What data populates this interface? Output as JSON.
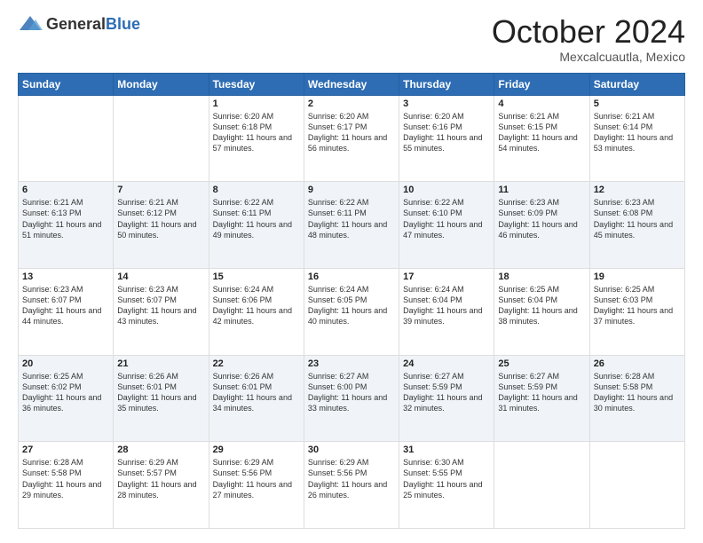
{
  "header": {
    "logo_general": "General",
    "logo_blue": "Blue",
    "month_title": "October 2024",
    "location": "Mexcalcuautla, Mexico"
  },
  "weekdays": [
    "Sunday",
    "Monday",
    "Tuesday",
    "Wednesday",
    "Thursday",
    "Friday",
    "Saturday"
  ],
  "weeks": [
    [
      {
        "day": "",
        "sunrise": "",
        "sunset": "",
        "daylight": ""
      },
      {
        "day": "",
        "sunrise": "",
        "sunset": "",
        "daylight": ""
      },
      {
        "day": "1",
        "sunrise": "Sunrise: 6:20 AM",
        "sunset": "Sunset: 6:18 PM",
        "daylight": "Daylight: 11 hours and 57 minutes."
      },
      {
        "day": "2",
        "sunrise": "Sunrise: 6:20 AM",
        "sunset": "Sunset: 6:17 PM",
        "daylight": "Daylight: 11 hours and 56 minutes."
      },
      {
        "day": "3",
        "sunrise": "Sunrise: 6:20 AM",
        "sunset": "Sunset: 6:16 PM",
        "daylight": "Daylight: 11 hours and 55 minutes."
      },
      {
        "day": "4",
        "sunrise": "Sunrise: 6:21 AM",
        "sunset": "Sunset: 6:15 PM",
        "daylight": "Daylight: 11 hours and 54 minutes."
      },
      {
        "day": "5",
        "sunrise": "Sunrise: 6:21 AM",
        "sunset": "Sunset: 6:14 PM",
        "daylight": "Daylight: 11 hours and 53 minutes."
      }
    ],
    [
      {
        "day": "6",
        "sunrise": "Sunrise: 6:21 AM",
        "sunset": "Sunset: 6:13 PM",
        "daylight": "Daylight: 11 hours and 51 minutes."
      },
      {
        "day": "7",
        "sunrise": "Sunrise: 6:21 AM",
        "sunset": "Sunset: 6:12 PM",
        "daylight": "Daylight: 11 hours and 50 minutes."
      },
      {
        "day": "8",
        "sunrise": "Sunrise: 6:22 AM",
        "sunset": "Sunset: 6:11 PM",
        "daylight": "Daylight: 11 hours and 49 minutes."
      },
      {
        "day": "9",
        "sunrise": "Sunrise: 6:22 AM",
        "sunset": "Sunset: 6:11 PM",
        "daylight": "Daylight: 11 hours and 48 minutes."
      },
      {
        "day": "10",
        "sunrise": "Sunrise: 6:22 AM",
        "sunset": "Sunset: 6:10 PM",
        "daylight": "Daylight: 11 hours and 47 minutes."
      },
      {
        "day": "11",
        "sunrise": "Sunrise: 6:23 AM",
        "sunset": "Sunset: 6:09 PM",
        "daylight": "Daylight: 11 hours and 46 minutes."
      },
      {
        "day": "12",
        "sunrise": "Sunrise: 6:23 AM",
        "sunset": "Sunset: 6:08 PM",
        "daylight": "Daylight: 11 hours and 45 minutes."
      }
    ],
    [
      {
        "day": "13",
        "sunrise": "Sunrise: 6:23 AM",
        "sunset": "Sunset: 6:07 PM",
        "daylight": "Daylight: 11 hours and 44 minutes."
      },
      {
        "day": "14",
        "sunrise": "Sunrise: 6:23 AM",
        "sunset": "Sunset: 6:07 PM",
        "daylight": "Daylight: 11 hours and 43 minutes."
      },
      {
        "day": "15",
        "sunrise": "Sunrise: 6:24 AM",
        "sunset": "Sunset: 6:06 PM",
        "daylight": "Daylight: 11 hours and 42 minutes."
      },
      {
        "day": "16",
        "sunrise": "Sunrise: 6:24 AM",
        "sunset": "Sunset: 6:05 PM",
        "daylight": "Daylight: 11 hours and 40 minutes."
      },
      {
        "day": "17",
        "sunrise": "Sunrise: 6:24 AM",
        "sunset": "Sunset: 6:04 PM",
        "daylight": "Daylight: 11 hours and 39 minutes."
      },
      {
        "day": "18",
        "sunrise": "Sunrise: 6:25 AM",
        "sunset": "Sunset: 6:04 PM",
        "daylight": "Daylight: 11 hours and 38 minutes."
      },
      {
        "day": "19",
        "sunrise": "Sunrise: 6:25 AM",
        "sunset": "Sunset: 6:03 PM",
        "daylight": "Daylight: 11 hours and 37 minutes."
      }
    ],
    [
      {
        "day": "20",
        "sunrise": "Sunrise: 6:25 AM",
        "sunset": "Sunset: 6:02 PM",
        "daylight": "Daylight: 11 hours and 36 minutes."
      },
      {
        "day": "21",
        "sunrise": "Sunrise: 6:26 AM",
        "sunset": "Sunset: 6:01 PM",
        "daylight": "Daylight: 11 hours and 35 minutes."
      },
      {
        "day": "22",
        "sunrise": "Sunrise: 6:26 AM",
        "sunset": "Sunset: 6:01 PM",
        "daylight": "Daylight: 11 hours and 34 minutes."
      },
      {
        "day": "23",
        "sunrise": "Sunrise: 6:27 AM",
        "sunset": "Sunset: 6:00 PM",
        "daylight": "Daylight: 11 hours and 33 minutes."
      },
      {
        "day": "24",
        "sunrise": "Sunrise: 6:27 AM",
        "sunset": "Sunset: 5:59 PM",
        "daylight": "Daylight: 11 hours and 32 minutes."
      },
      {
        "day": "25",
        "sunrise": "Sunrise: 6:27 AM",
        "sunset": "Sunset: 5:59 PM",
        "daylight": "Daylight: 11 hours and 31 minutes."
      },
      {
        "day": "26",
        "sunrise": "Sunrise: 6:28 AM",
        "sunset": "Sunset: 5:58 PM",
        "daylight": "Daylight: 11 hours and 30 minutes."
      }
    ],
    [
      {
        "day": "27",
        "sunrise": "Sunrise: 6:28 AM",
        "sunset": "Sunset: 5:58 PM",
        "daylight": "Daylight: 11 hours and 29 minutes."
      },
      {
        "day": "28",
        "sunrise": "Sunrise: 6:29 AM",
        "sunset": "Sunset: 5:57 PM",
        "daylight": "Daylight: 11 hours and 28 minutes."
      },
      {
        "day": "29",
        "sunrise": "Sunrise: 6:29 AM",
        "sunset": "Sunset: 5:56 PM",
        "daylight": "Daylight: 11 hours and 27 minutes."
      },
      {
        "day": "30",
        "sunrise": "Sunrise: 6:29 AM",
        "sunset": "Sunset: 5:56 PM",
        "daylight": "Daylight: 11 hours and 26 minutes."
      },
      {
        "day": "31",
        "sunrise": "Sunrise: 6:30 AM",
        "sunset": "Sunset: 5:55 PM",
        "daylight": "Daylight: 11 hours and 25 minutes."
      },
      {
        "day": "",
        "sunrise": "",
        "sunset": "",
        "daylight": ""
      },
      {
        "day": "",
        "sunrise": "",
        "sunset": "",
        "daylight": ""
      }
    ]
  ]
}
